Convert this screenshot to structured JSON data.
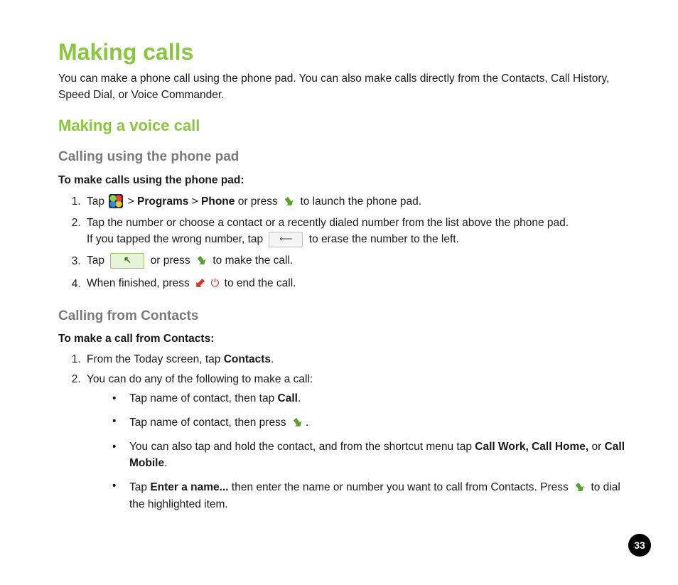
{
  "page": {
    "number": "33"
  },
  "title": "Making calls",
  "intro": "You can make a phone call using the phone pad. You can also make calls directly from the Contacts, Call History, Speed Dial, or Voice Commander.",
  "sec1": {
    "heading": "Making a voice call",
    "sub1": {
      "heading": "Calling using the phone pad",
      "lead": "To make calls using the phone pad:",
      "step1": {
        "a": "Tap ",
        "gt1": " > ",
        "programs": "Programs",
        "gt2": " > ",
        "phone": "Phone",
        "b": " or press ",
        "c": " to launch the phone pad."
      },
      "step2": {
        "a": "Tap the number or choose a contact or a recently dialed number from the list above the phone pad.",
        "b1": "If you tapped the wrong number, tap ",
        "b2": " to erase the number to the left."
      },
      "step3": {
        "a": "Tap ",
        "b": " or press ",
        "c": " to make the call."
      },
      "step4": {
        "a": "When finished, press ",
        "b": " to end the call."
      }
    },
    "sub2": {
      "heading": "Calling from Contacts",
      "lead": "To make a call from Contacts:",
      "step1": {
        "a": "From the Today screen, tap ",
        "contacts": "Contacts",
        "b": "."
      },
      "step2": {
        "a": "You can do any of the following to make a call:",
        "i1": {
          "a": "Tap name of contact, then tap ",
          "call": "Call",
          "b": "."
        },
        "i2": {
          "a": "Tap name of contact, then press ",
          "b": "."
        },
        "i3": {
          "a": "You can also tap and hold the contact, and from the shortcut menu tap ",
          "cw": "Call Work, Call Home,",
          "or": " or ",
          "cm": "Call Mobile",
          "b": "."
        },
        "i4": {
          "a": "Tap ",
          "en": "Enter a name...",
          "b": " then enter the name or number you want to call from Contacts. Press ",
          "c": " to dial the highlighted item."
        }
      }
    }
  }
}
